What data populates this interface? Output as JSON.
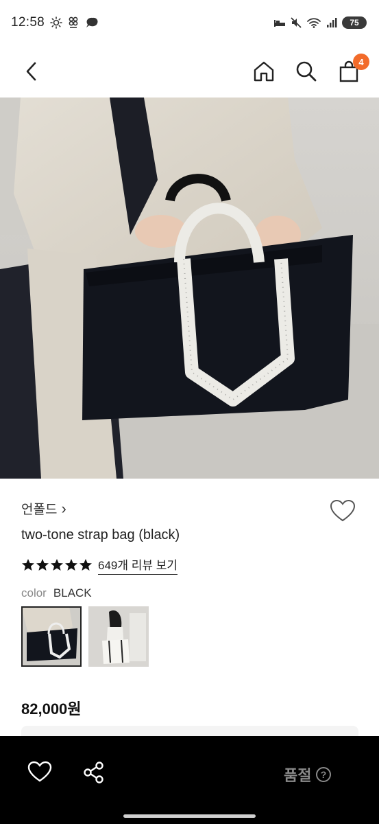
{
  "status_bar": {
    "time": "12:58",
    "battery": "75"
  },
  "nav": {
    "cart_count": "4"
  },
  "product": {
    "brand": "언폴드",
    "brand_chevron": "›",
    "name": "two-tone strap bag (black)",
    "rating_stars": 5,
    "review_link": "649개 리뷰 보기",
    "color_label": "color",
    "color_value": "BLACK",
    "price": "82,000원"
  },
  "bottom_bar": {
    "status": "품절",
    "help_symbol": "?"
  }
}
